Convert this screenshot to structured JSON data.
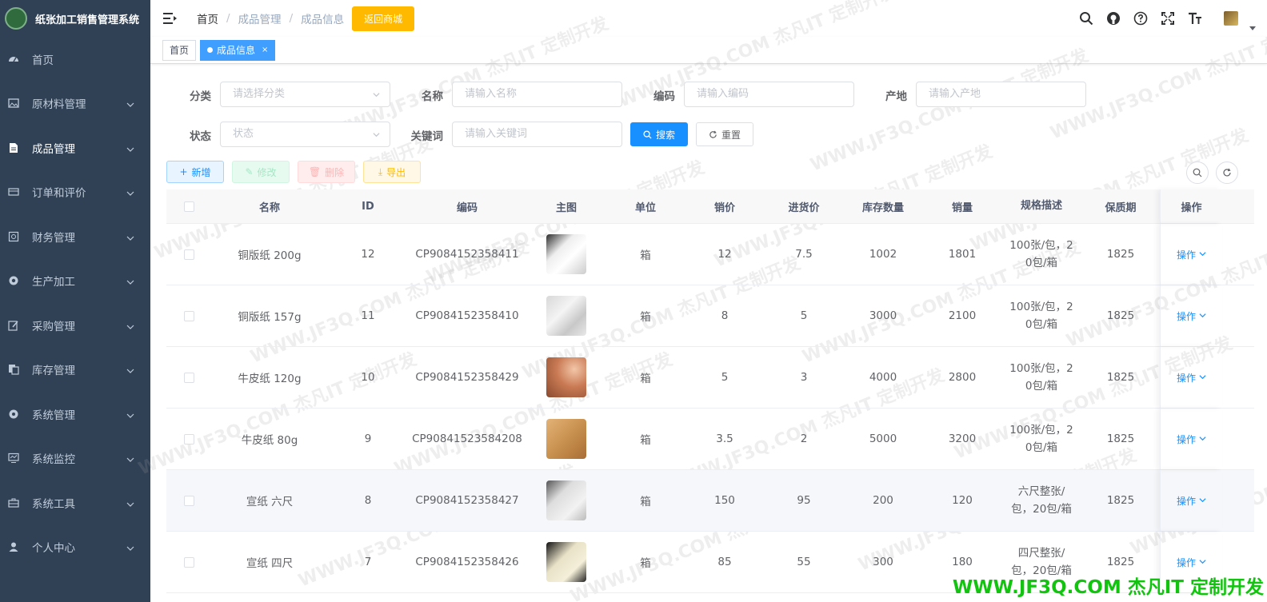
{
  "app": {
    "title": "纸张加工销售管理系统"
  },
  "sidebar": {
    "items": [
      {
        "label": "首页",
        "icon": "dashboard-icon",
        "has_children": false,
        "active": false
      },
      {
        "label": "原材料管理",
        "icon": "image-icon",
        "has_children": true,
        "active": false
      },
      {
        "label": "成品管理",
        "icon": "document-icon",
        "has_children": true,
        "active": true
      },
      {
        "label": "订单和评价",
        "icon": "card-icon",
        "has_children": true,
        "active": false
      },
      {
        "label": "财务管理",
        "icon": "finance-icon",
        "has_children": true,
        "active": false
      },
      {
        "label": "生产加工",
        "icon": "gear-cycle-icon",
        "has_children": true,
        "active": false
      },
      {
        "label": "采购管理",
        "icon": "edit-icon",
        "has_children": true,
        "active": false
      },
      {
        "label": "库存管理",
        "icon": "copy-icon",
        "has_children": true,
        "active": false
      },
      {
        "label": "系统管理",
        "icon": "settings-icon",
        "has_children": true,
        "active": false
      },
      {
        "label": "系统监控",
        "icon": "monitor-icon",
        "has_children": true,
        "active": false
      },
      {
        "label": "系统工具",
        "icon": "toolbox-icon",
        "has_children": true,
        "active": false
      },
      {
        "label": "个人中心",
        "icon": "user-icon",
        "has_children": true,
        "active": false
      }
    ]
  },
  "header": {
    "breadcrumb": [
      "首页",
      "成品管理",
      "成品信息"
    ],
    "back_button": "返回商城"
  },
  "tags": {
    "home": "首页",
    "current": "成品信息",
    "close": "×"
  },
  "search": {
    "category_label": "分类",
    "category_placeholder": "请选择分类",
    "name_label": "名称",
    "name_placeholder": "请输入名称",
    "code_label": "编码",
    "code_placeholder": "请输入编码",
    "origin_label": "产地",
    "origin_placeholder": "请输入产地",
    "status_label": "状态",
    "status_placeholder": "状态",
    "keyword_label": "关键词",
    "keyword_placeholder": "请输入关键词",
    "search_button": "搜索",
    "reset_button": "重置"
  },
  "toolbar": {
    "add": "新增",
    "edit": "修改",
    "delete": "删除",
    "export": "导出"
  },
  "table": {
    "headers": [
      "名称",
      "ID",
      "编码",
      "主图",
      "单位",
      "销价",
      "进货价",
      "库存数量",
      "销量",
      "规格描述",
      "保质期",
      "操作"
    ],
    "op_label": "操作",
    "rows": [
      {
        "name": "铜版纸 200g",
        "id": "12",
        "code": "CP9084152358411",
        "unit": "箱",
        "price": "12",
        "cost": "7.5",
        "stock": "1002",
        "sales": "1801",
        "spec1": "100张/包，2",
        "spec2": "0包/箱",
        "life": "1825",
        "img": "paper-white"
      },
      {
        "name": "铜版纸 157g",
        "id": "11",
        "code": "CP9084152358410",
        "unit": "箱",
        "price": "8",
        "cost": "5",
        "stock": "3000",
        "sales": "2100",
        "spec1": "100张/包，2",
        "spec2": "0包/箱",
        "life": "1825",
        "img": "paper-gray"
      },
      {
        "name": "牛皮纸 120g",
        "id": "10",
        "code": "CP9084152358429",
        "unit": "箱",
        "price": "5",
        "cost": "3",
        "stock": "4000",
        "sales": "2800",
        "spec1": "100张/包，2",
        "spec2": "0包/箱",
        "life": "1825",
        "img": "kraft-roll"
      },
      {
        "name": "牛皮纸 80g",
        "id": "9",
        "code": "CP90841523584208",
        "unit": "箱",
        "price": "3.5",
        "cost": "2",
        "stock": "5000",
        "sales": "3200",
        "spec1": "100张/包，2",
        "spec2": "0包/箱",
        "life": "1825",
        "img": "kraft-sheet"
      },
      {
        "name": "宣纸 六尺",
        "id": "8",
        "code": "CP9084152358427",
        "unit": "箱",
        "price": "150",
        "cost": "95",
        "stock": "200",
        "sales": "120",
        "spec1": "六尺整张/",
        "spec2": "包，20包/箱",
        "life": "1825",
        "img": "rice-paper",
        "highlight": true
      },
      {
        "name": "宣纸 四尺",
        "id": "7",
        "code": "CP9084152358426",
        "unit": "箱",
        "price": "85",
        "cost": "55",
        "stock": "300",
        "sales": "180",
        "spec1": "四尺整张/",
        "spec2": "包，20包/箱",
        "life": "1825",
        "img": "rice-paper-dark"
      }
    ]
  },
  "watermark": {
    "text": "WWW.JF3Q.COM 杰凡IT 定制开发"
  },
  "footer_watermark": "WWW.JF3Q.COM 杰凡IT 定制开发",
  "colors": {
    "sidebar_bg": "#304156",
    "primary": "#1890ff",
    "warning": "#ffba00",
    "watermark_green": "#12c40f"
  }
}
